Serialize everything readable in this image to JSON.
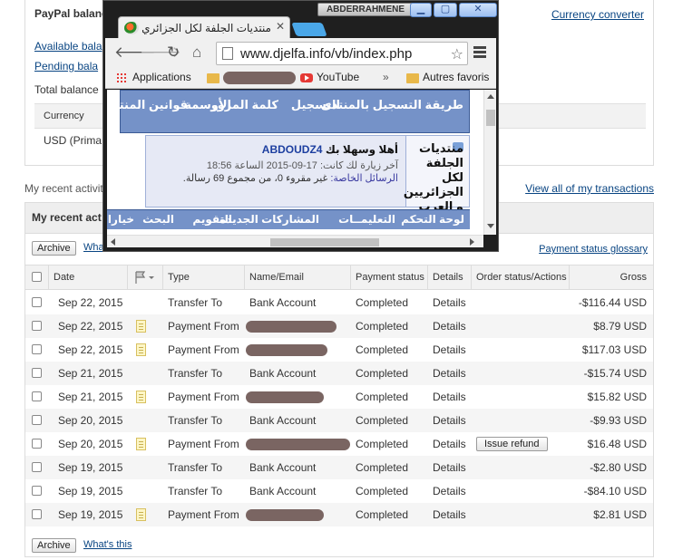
{
  "paypal": {
    "balance_title": "PayPal balanc",
    "currency_converter": "Currency converter",
    "available": "Available bala",
    "pending": "Pending bala",
    "total": "Total balance",
    "currency_header": "Currency",
    "currency_row": "USD (Prima",
    "recent_activity": "My recent activit",
    "view_all": "View all of my transactions",
    "recent_header": "My recent act",
    "archive": "Archive",
    "whats_this_top": "Wha",
    "whats_this": "What's this",
    "glossary": "Payment status glossary",
    "columns": {
      "date": "Date",
      "type": "Type",
      "name": "Name/Email",
      "status": "Payment status",
      "details": "Details",
      "order": "Order status/Actions",
      "gross": "Gross"
    },
    "rows": [
      {
        "date": "Sep 22, 2015",
        "type": "Transfer To",
        "name": "Bank Account",
        "status": "Completed",
        "details": "Details",
        "gross": "-$116.44 USD",
        "note": false,
        "redacted": false
      },
      {
        "date": "Sep 22, 2015",
        "type": "Payment From",
        "name": "",
        "status": "Completed",
        "details": "Details",
        "gross": "$8.79 USD",
        "note": true,
        "redacted": true
      },
      {
        "date": "Sep 22, 2015",
        "type": "Payment From",
        "name": "",
        "status": "Completed",
        "details": "Details",
        "gross": "$117.03 USD",
        "note": true,
        "redacted": true
      },
      {
        "date": "Sep 21, 2015",
        "type": "Transfer To",
        "name": "Bank Account",
        "status": "Completed",
        "details": "Details",
        "gross": "-$15.74 USD",
        "note": false,
        "redacted": false
      },
      {
        "date": "Sep 21, 2015",
        "type": "Payment From",
        "name": "",
        "status": "Completed",
        "details": "Details",
        "gross": "$15.82 USD",
        "note": true,
        "redacted": true
      },
      {
        "date": "Sep 20, 2015",
        "type": "Transfer To",
        "name": "Bank Account",
        "status": "Completed",
        "details": "Details",
        "gross": "-$9.93 USD",
        "note": false,
        "redacted": false
      },
      {
        "date": "Sep 20, 2015",
        "type": "Payment From",
        "name": "",
        "status": "Completed",
        "details": "Details",
        "gross": "$16.48 USD",
        "note": true,
        "redacted": true,
        "action": "Issue refund"
      },
      {
        "date": "Sep 19, 2015",
        "type": "Transfer To",
        "name": "Bank Account",
        "status": "Completed",
        "details": "Details",
        "gross": "-$2.80 USD",
        "note": false,
        "redacted": false
      },
      {
        "date": "Sep 19, 2015",
        "type": "Transfer To",
        "name": "Bank Account",
        "status": "Completed",
        "details": "Details",
        "gross": "-$84.10 USD",
        "note": false,
        "redacted": false
      },
      {
        "date": "Sep 19, 2015",
        "type": "Payment From",
        "name": "",
        "status": "Completed",
        "details": "Details",
        "gross": "$2.81 USD",
        "note": true,
        "redacted": true
      }
    ]
  },
  "browser": {
    "system_label": "ABDERRAHMENE",
    "tab_title": "منتديات الجلفة لكل الجزائري",
    "url": "www.djelfa.info/vb/index.php",
    "bookmarks": {
      "apps": "Applications",
      "youtube": "YouTube",
      "more": "»",
      "other": "Autres favoris"
    },
    "page": {
      "nav_top": [
        "طريقة التسجيل بالمنتدى",
        "التسجيل",
        "كلمة المرور",
        "الأوسمة",
        "قوانين المنتدى"
      ],
      "logo": "منتديات الجلفة لكل الجزائريين و العرب",
      "welcome_prefix": "أهلا وسهلا بك",
      "username": "ABDOUDZ4",
      "last_visit": "آخر زيارة لك كانت: 17-09-2015 الساعة 18:56",
      "pm_label": "الرسائل الخاصة:",
      "pm_text": "غير مقروء 0، من مجموع 69 رسالة.",
      "nav_bottom": [
        "لوحة التحكم",
        "التعليمــات",
        "المشاركات الجديدة",
        "التقويم",
        "البحث",
        "خيارات"
      ]
    }
  }
}
